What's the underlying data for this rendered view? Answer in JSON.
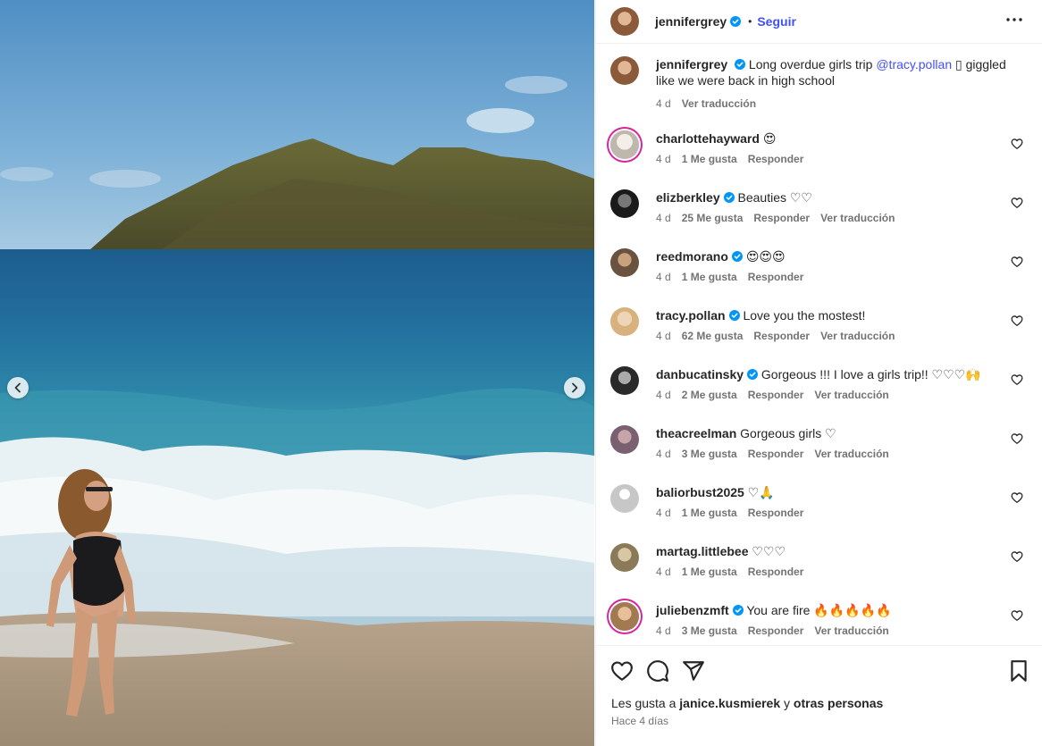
{
  "header": {
    "username": "jennifergrey",
    "separator": "•",
    "follow_label": "Seguir"
  },
  "caption": {
    "username": "jennifergrey",
    "text_before": "Long overdue girls trip",
    "mention": "@tracy.pollan",
    "text_after": "▯ giggled like we were back in high school",
    "time": "4 d",
    "translate": "Ver traducción"
  },
  "comments": [
    {
      "username": "charlottehayward",
      "verified": false,
      "text": "😍",
      "time": "4 d",
      "likes": "1 Me gusta",
      "reply": "Responder",
      "translate": ""
    },
    {
      "username": "elizberkley",
      "verified": true,
      "text": "Beauties ♡♡",
      "time": "4 d",
      "likes": "25 Me gusta",
      "reply": "Responder",
      "translate": "Ver traducción"
    },
    {
      "username": "reedmorano",
      "verified": true,
      "text": "😍😍😍",
      "time": "4 d",
      "likes": "1 Me gusta",
      "reply": "Responder",
      "translate": ""
    },
    {
      "username": "tracy.pollan",
      "verified": true,
      "text": "Love you the mostest!",
      "time": "4 d",
      "likes": "62 Me gusta",
      "reply": "Responder",
      "translate": "Ver traducción"
    },
    {
      "username": "danbucatinsky",
      "verified": true,
      "text": "Gorgeous !!! I love a girls trip!! ♡♡♡🙌",
      "time": "4 d",
      "likes": "2 Me gusta",
      "reply": "Responder",
      "translate": "Ver traducción"
    },
    {
      "username": "theacreelman",
      "verified": false,
      "text": "Gorgeous girls ♡",
      "time": "4 d",
      "likes": "3 Me gusta",
      "reply": "Responder",
      "translate": "Ver traducción"
    },
    {
      "username": "baliorbust2025",
      "verified": false,
      "text": "♡🙏",
      "time": "4 d",
      "likes": "1 Me gusta",
      "reply": "Responder",
      "translate": ""
    },
    {
      "username": "martag.littlebee",
      "verified": false,
      "text": "♡♡♡",
      "time": "4 d",
      "likes": "1 Me gusta",
      "reply": "Responder",
      "translate": ""
    },
    {
      "username": "juliebenzmft",
      "verified": true,
      "text": "You are fire 🔥🔥🔥🔥🔥",
      "time": "4 d",
      "likes": "3 Me gusta",
      "reply": "Responder",
      "translate": "Ver traducción"
    }
  ],
  "footer": {
    "likes_prefix": "Les gusta a",
    "likes_user": "janice.kusmierek",
    "likes_join": "y",
    "likes_others": "otras personas",
    "posted": "Hace 4 días"
  },
  "colors": {
    "link": "#4150f7",
    "verified": "#0095f6",
    "muted": "#737373",
    "text": "#262626",
    "story_ring": "#d6249f"
  },
  "icons": [
    "chevron-left-icon",
    "chevron-right-icon",
    "verified-icon",
    "more-icon",
    "heart-icon",
    "comment-icon",
    "share-icon",
    "bookmark-icon"
  ]
}
